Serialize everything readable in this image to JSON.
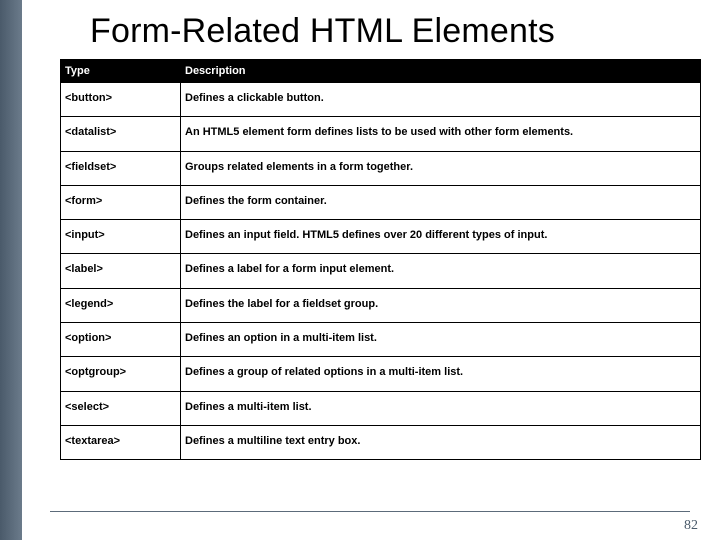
{
  "title": "Form-Related HTML Elements",
  "page_number": "82",
  "table": {
    "headers": {
      "type": "Type",
      "desc": "Description"
    },
    "rows": [
      {
        "type": "<button>",
        "desc": "Defines a clickable button."
      },
      {
        "type": "<datalist>",
        "desc": "An HTML5 element form defines lists to be used with other form elements."
      },
      {
        "type": "<fieldset>",
        "desc": "Groups related elements in a form together."
      },
      {
        "type": "<form>",
        "desc": "Defines the form container."
      },
      {
        "type": "<input>",
        "desc": "Defines an input field. HTML5 defines over 20 different types of input."
      },
      {
        "type": "<label>",
        "desc": "Defines a label for a form input element."
      },
      {
        "type": "<legend>",
        "desc": "Defines the label for a fieldset group."
      },
      {
        "type": "<option>",
        "desc": "Defines an option in a multi-item list."
      },
      {
        "type": "<optgroup>",
        "desc": "Defines a group of related options in a multi-item list."
      },
      {
        "type": "<select>",
        "desc": "Defines a multi-item list."
      },
      {
        "type": "<textarea>",
        "desc": "Defines a multiline text entry box."
      }
    ]
  }
}
